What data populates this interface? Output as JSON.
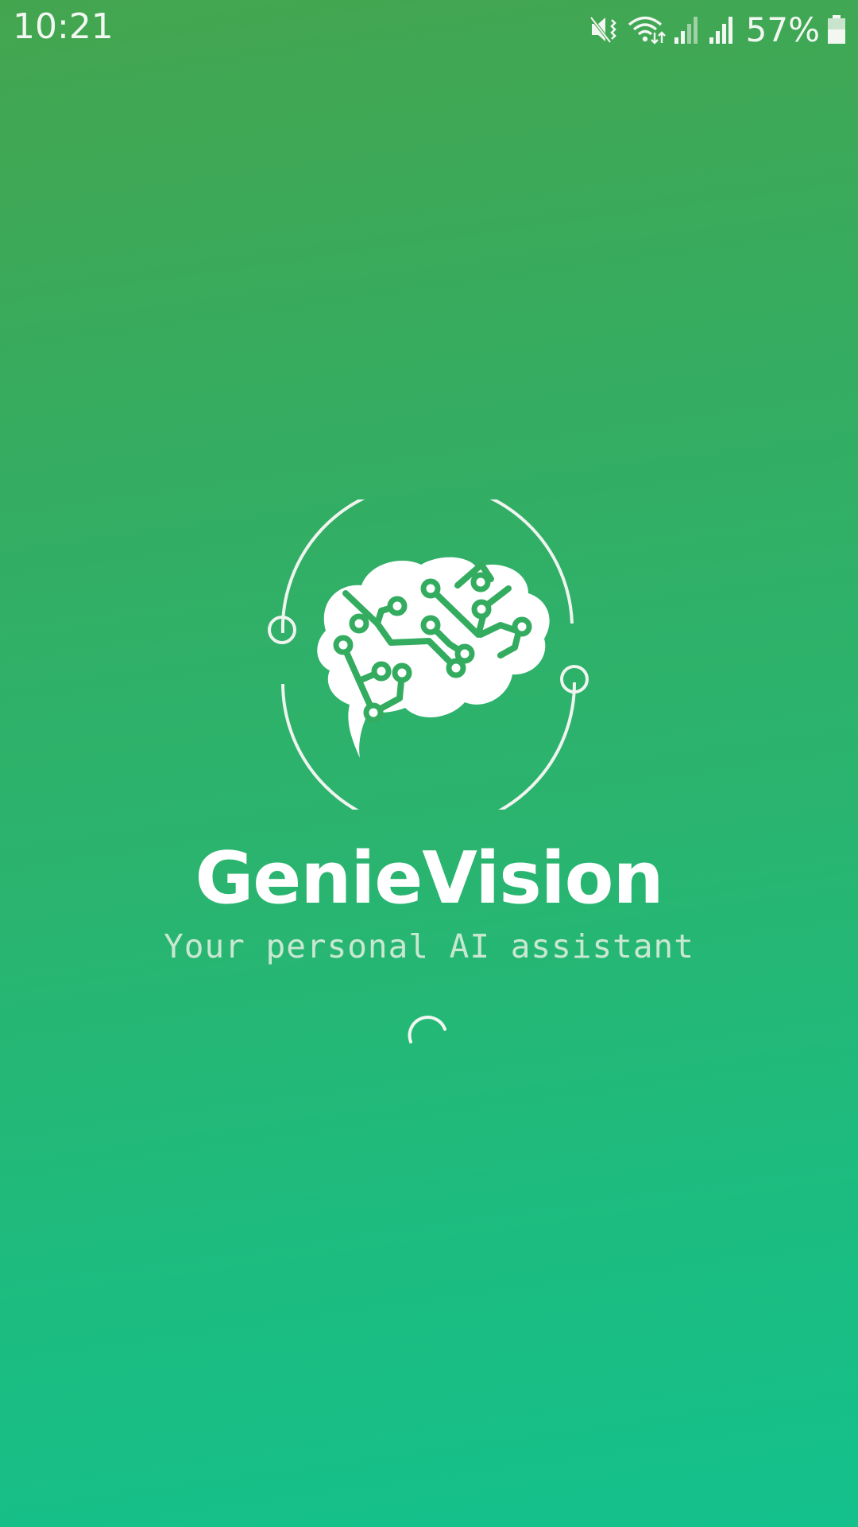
{
  "status_bar": {
    "time": "10:21",
    "battery_percent": "57%",
    "icons": [
      "mute-vibrate-icon",
      "wifi-icon",
      "signal-icon",
      "signal-icon",
      "battery-icon"
    ]
  },
  "splash": {
    "app_name": "GenieVision",
    "tagline": "Your personal AI assistant",
    "logo_icon": "brain-circuit-icon",
    "loading_icon": "spinner-icon"
  },
  "colors": {
    "gradient_top": "#44a54f",
    "gradient_bottom": "#14c18c",
    "foreground": "#ffffff",
    "tagline": "#c9e8d2"
  }
}
